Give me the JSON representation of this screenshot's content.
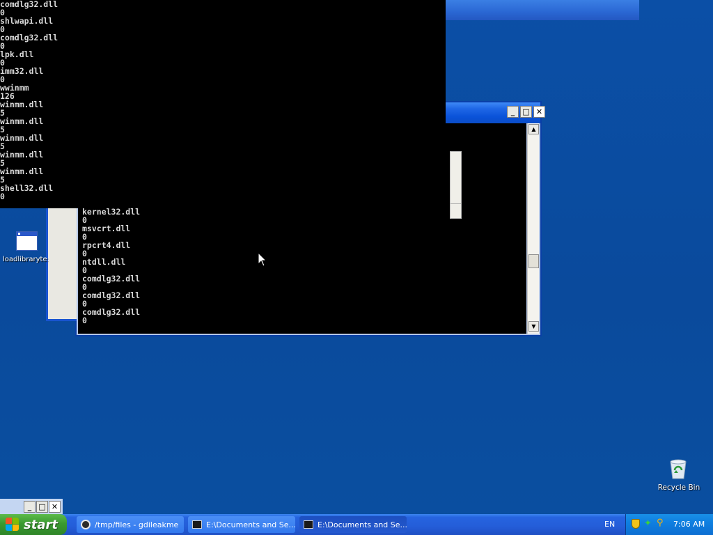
{
  "desktop": {
    "icons": [
      {
        "label": "loadlibraryte:",
        "icon": "application-window-icon"
      },
      {
        "label": "Recycle Bin",
        "icon": "recycle-bin-icon"
      }
    ]
  },
  "console_front": {
    "lines": [
      "comdlg32.dll",
      "0",
      "shlwapi.dll",
      "0",
      "comdlg32.dll",
      "0",
      "lpk.dll",
      "0",
      "imm32.dll",
      "0",
      "wwinmm",
      "126",
      "winmm.dll",
      "5",
      "winmm.dll",
      "5",
      "winmm.dll",
      "5",
      "winmm.dll",
      "5",
      "winmm.dll",
      "5",
      "shell32.dll",
      "0",
      "_"
    ]
  },
  "console_back": {
    "lines": [
      "kernel32.dll",
      "0",
      "msvcrt.dll",
      "0",
      "rpcrt4.dll",
      "0",
      "ntdll.dll",
      "0",
      "comdlg32.dll",
      "0",
      "comdlg32.dll",
      "0",
      "comdlg32.dll",
      "0"
    ],
    "buttons": {
      "minimize": "_",
      "maximize": "□",
      "close": "✕"
    }
  },
  "mini_window": {
    "buttons": {
      "minimize": "_",
      "maximize": "□",
      "close": "✕"
    }
  },
  "taskbar": {
    "start_label": "start",
    "tasks": [
      {
        "label": "/tmp/files - gdileakme",
        "icon": "cygwin-icon",
        "active": false
      },
      {
        "label": "E:\\Documents and Se...",
        "icon": "console-icon",
        "active": false
      },
      {
        "label": "E:\\Documents and Se...",
        "icon": "console-icon",
        "active": true
      }
    ],
    "language": "EN",
    "clock": "7:06 AM"
  }
}
